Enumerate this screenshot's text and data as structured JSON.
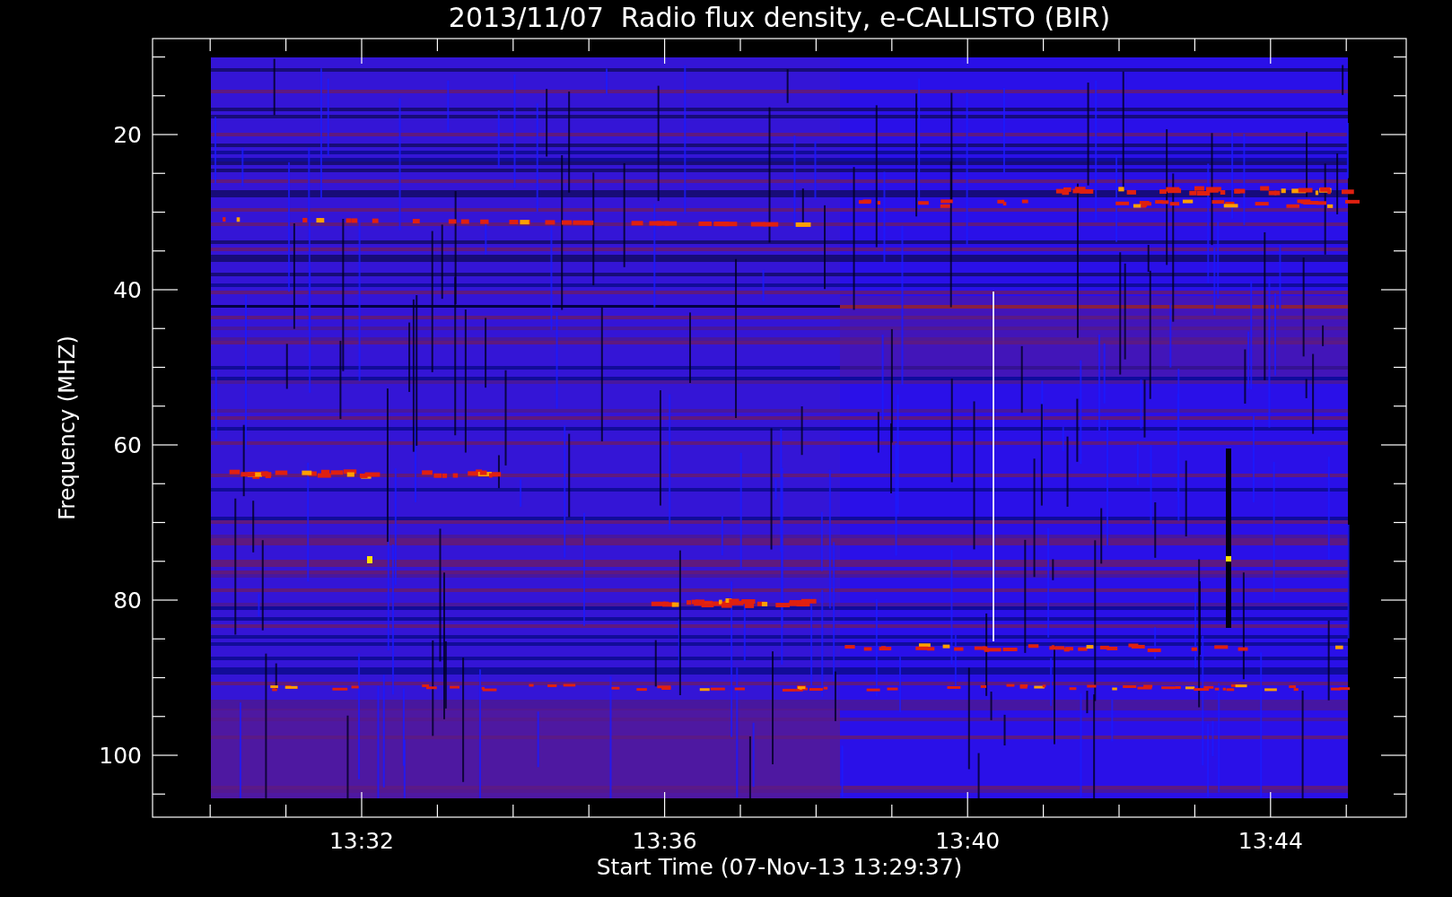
{
  "title": "2013/11/07  Radio flux density, e-CALLISTO (BIR)",
  "y_axis": {
    "label": "Frequency (MHZ)",
    "ticks": [
      "20",
      "40",
      "60",
      "80",
      "100"
    ]
  },
  "x_axis": {
    "label": "Start Time (07-Nov-13 13:29:37)",
    "ticks": [
      "13:32",
      "13:36",
      "13:40",
      "13:44"
    ]
  }
}
